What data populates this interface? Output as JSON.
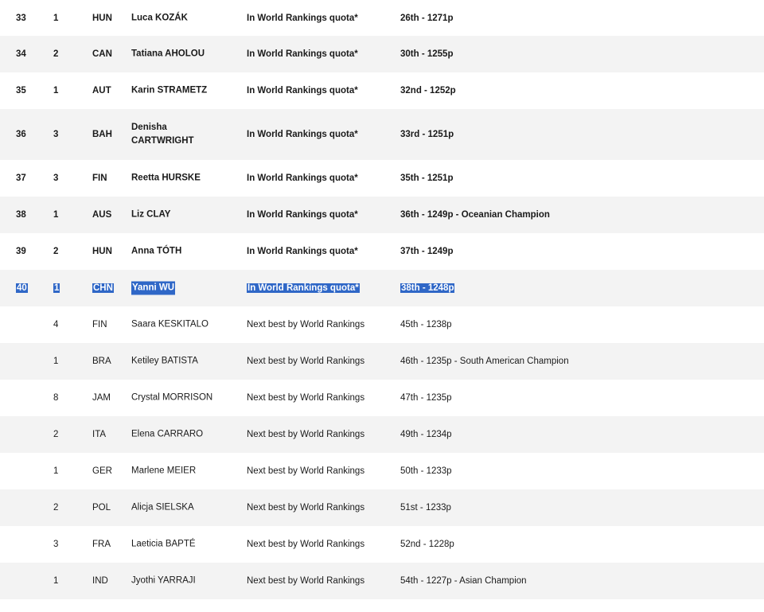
{
  "rows": [
    {
      "rank": "33",
      "num": "1",
      "nat": "HUN",
      "name": "Luca KOZÁK",
      "quota": "In World Rankings quota*",
      "ranking": "26th - 1271p"
    },
    {
      "rank": "34",
      "num": "2",
      "nat": "CAN",
      "name": "Tatiana AHOLOU",
      "quota": "In World Rankings quota*",
      "ranking": "30th - 1255p"
    },
    {
      "rank": "35",
      "num": "1",
      "nat": "AUT",
      "name": "Karin STRAMETZ",
      "quota": "In World Rankings quota*",
      "ranking": "32nd - 1252p"
    },
    {
      "rank": "36",
      "num": "3",
      "nat": "BAH",
      "name": "Denisha CARTWRIGHT",
      "quota": "In World Rankings quota*",
      "ranking": "33rd - 1251p"
    },
    {
      "rank": "37",
      "num": "3",
      "nat": "FIN",
      "name": "Reetta HURSKE",
      "quota": "In World Rankings quota*",
      "ranking": "35th - 1251p"
    },
    {
      "rank": "38",
      "num": "1",
      "nat": "AUS",
      "name": "Liz CLAY",
      "quota": "In World Rankings quota*",
      "ranking": "36th - 1249p - Oceanian Champion"
    },
    {
      "rank": "39",
      "num": "2",
      "nat": "HUN",
      "name": "Anna TÓTH",
      "quota": "In World Rankings quota*",
      "ranking": "37th - 1249p"
    },
    {
      "rank": "40",
      "num": "1",
      "nat": "CHN",
      "name": "Yanni WU",
      "quota": "In World Rankings quota*",
      "ranking": "38th - 1248p"
    },
    {
      "rank": "",
      "num": "4",
      "nat": "FIN",
      "name": "Saara KESKITALO",
      "quota": "Next best by World Rankings",
      "ranking": "45th - 1238p"
    },
    {
      "rank": "",
      "num": "1",
      "nat": "BRA",
      "name": "Ketiley BATISTA",
      "quota": "Next best by World Rankings",
      "ranking": "46th - 1235p - South American Champion"
    },
    {
      "rank": "",
      "num": "8",
      "nat": "JAM",
      "name": "Crystal MORRISON",
      "quota": "Next best by World Rankings",
      "ranking": "47th - 1235p"
    },
    {
      "rank": "",
      "num": "2",
      "nat": "ITA",
      "name": "Elena CARRARO",
      "quota": "Next best by World Rankings",
      "ranking": "49th - 1234p"
    },
    {
      "rank": "",
      "num": "1",
      "nat": "GER",
      "name": "Marlene MEIER",
      "quota": "Next best by World Rankings",
      "ranking": "50th - 1233p"
    },
    {
      "rank": "",
      "num": "2",
      "nat": "POL",
      "name": "Alicja SIELSKA",
      "quota": "Next best by World Rankings",
      "ranking": "51st - 1233p"
    },
    {
      "rank": "",
      "num": "3",
      "nat": "FRA",
      "name": "Laeticia BAPTÉ",
      "quota": "Next best by World Rankings",
      "ranking": "52nd - 1228p"
    },
    {
      "rank": "",
      "num": "1",
      "nat": "IND",
      "name": "Jyothi YARRAJI",
      "quota": "Next best by World Rankings",
      "ranking": "54th - 1227p - Asian Champion"
    }
  ]
}
